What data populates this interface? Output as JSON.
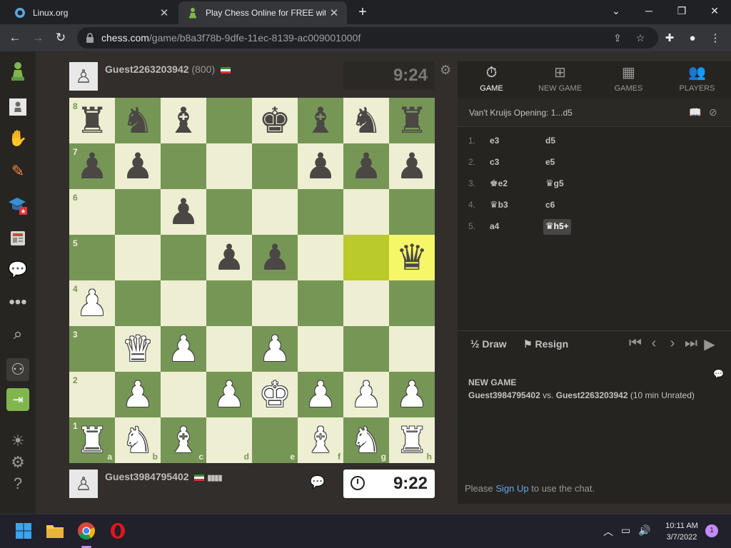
{
  "browser": {
    "tabs": [
      {
        "title": "Linux.org",
        "favicon": "linux-org-icon"
      },
      {
        "title": "Play Chess Online for FREE with F",
        "favicon": "chess-pawn-icon"
      }
    ],
    "url_domain": "chess.com",
    "url_path": "/game/b8a3f78b-9dfe-11ec-8139-ac009001000f"
  },
  "players": {
    "top": {
      "name": "Guest2263203942",
      "rating": "(800)",
      "clock": "9:24"
    },
    "bottom": {
      "name": "Guest3984795402",
      "clock": "9:22"
    }
  },
  "board": {
    "ranks": [
      "8",
      "7",
      "6",
      "5",
      "4",
      "3",
      "2",
      "1"
    ],
    "files": [
      "a",
      "b",
      "c",
      "d",
      "e",
      "f",
      "g",
      "h"
    ],
    "position": [
      [
        "bR",
        "bN",
        "bB",
        "",
        "bK",
        "bB",
        "bN",
        "bR"
      ],
      [
        "bP",
        "bP",
        "",
        "",
        "",
        "bP",
        "bP",
        "bP"
      ],
      [
        "",
        "",
        "bP",
        "",
        "",
        "",
        "",
        ""
      ],
      [
        "",
        "",
        "",
        "bP",
        "bP",
        "",
        "",
        "bQ"
      ],
      [
        "wP",
        "",
        "",
        "",
        "",
        "",
        "",
        ""
      ],
      [
        "",
        "wQ",
        "wP",
        "",
        "wP",
        "",
        "",
        ""
      ],
      [
        "",
        "wP",
        "",
        "wP",
        "wK",
        "wP",
        "wP",
        "wP"
      ],
      [
        "wR",
        "wN",
        "wB",
        "",
        "",
        "wB",
        "wN",
        "wR"
      ]
    ],
    "last_move_squares": [
      "g5",
      "h5"
    ]
  },
  "panel": {
    "tabs": [
      {
        "label": "GAME",
        "icon": "stopwatch-icon"
      },
      {
        "label": "NEW GAME",
        "icon": "plus-square-icon"
      },
      {
        "label": "GAMES",
        "icon": "chessboard-icon"
      },
      {
        "label": "PLAYERS",
        "icon": "players-icon"
      }
    ],
    "opening": "Van't Kruijs Opening: 1...d5",
    "moves": [
      {
        "num": "1.",
        "white": "e3",
        "black": "d5"
      },
      {
        "num": "2.",
        "white": "c3",
        "black": "e5"
      },
      {
        "num": "3.",
        "white_fig": "♚",
        "white": "e2",
        "black_fig": "♛",
        "black": "g5"
      },
      {
        "num": "4.",
        "white_fig": "♛",
        "white": "b3",
        "black": "c6"
      },
      {
        "num": "5.",
        "white": "a4",
        "black_fig": "♛",
        "black": "h5+"
      }
    ],
    "draw_label": "Draw",
    "draw_glyph": "½",
    "resign_label": "Resign",
    "chat": {
      "heading": "NEW GAME",
      "player1": "Guest3984795402",
      "vs": " vs. ",
      "player2": "Guest2263203942",
      "details": " (10 min Unrated)",
      "signup_prefix": "Please ",
      "signup_link": "Sign Up",
      "signup_suffix": " to use the chat."
    }
  },
  "taskbar": {
    "time": "10:11 AM",
    "date": "3/7/2022",
    "notifications": "1"
  },
  "colors": {
    "light_square": "#eeeed2",
    "dark_square": "#769656",
    "highlight": "#f6f669"
  }
}
